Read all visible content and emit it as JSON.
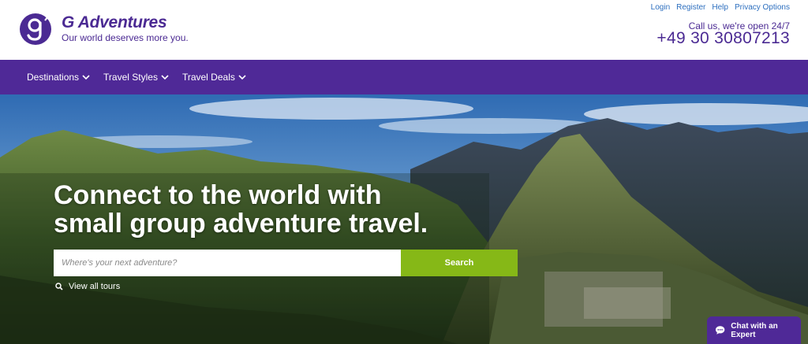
{
  "brand": {
    "name": "G Adventures",
    "tagline": "Our world deserves more you.",
    "color": "#4b2a93"
  },
  "top_links": {
    "login": "Login",
    "register": "Register",
    "help": "Help",
    "privacy": "Privacy Options"
  },
  "contact": {
    "callus": "Call us, we're open 24/7",
    "phone": "+49 30 30807213"
  },
  "nav": {
    "items": [
      {
        "label": "Destinations"
      },
      {
        "label": "Travel Styles"
      },
      {
        "label": "Travel Deals"
      }
    ],
    "background": "#4f2997"
  },
  "hero": {
    "headline_line1": "Connect to the world with",
    "headline_line2": "small group adventure travel.",
    "search_placeholder": "Where's your next adventure?",
    "search_button": "Search",
    "search_button_color": "#86b817",
    "view_all": "View all tours"
  },
  "chat": {
    "label": "Chat with an Expert"
  },
  "icons": [
    "g-logo-icon",
    "chevron-down-icon",
    "search-icon",
    "chat-bubble-icon"
  ]
}
